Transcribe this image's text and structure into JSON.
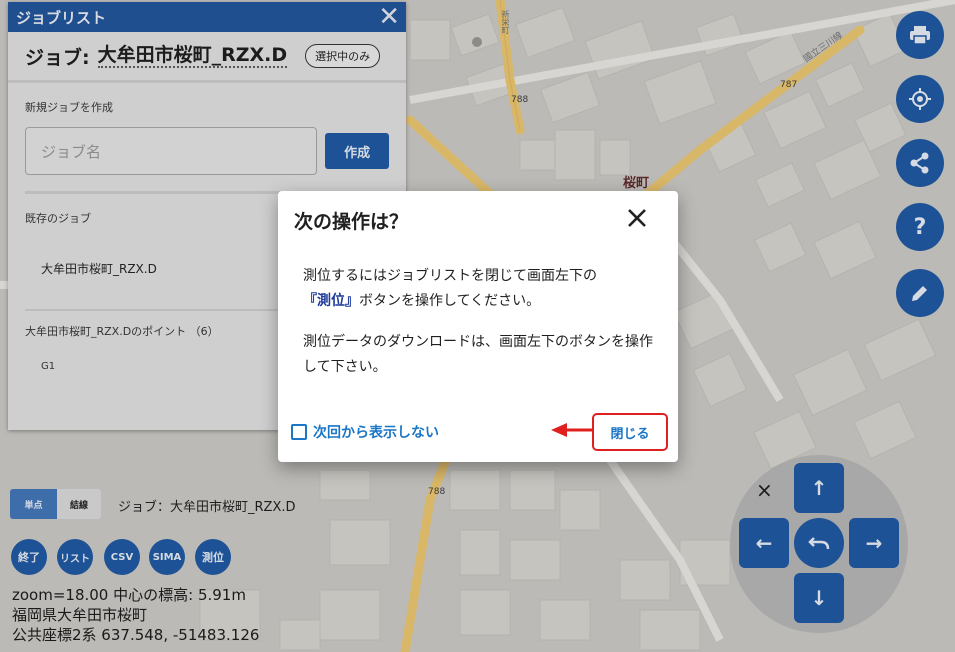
{
  "map": {
    "labels": {
      "road_788_a": "788",
      "road_787": "787",
      "road_788_b": "788",
      "district": "桜町",
      "road_sign_a": "新栄町",
      "road_sign_b": "國立三川線"
    },
    "colors": {
      "background": "#bcbab6",
      "road_major": "#d4b46a",
      "road_minor": "#cfcdc9",
      "building": "#c9c7c2"
    }
  },
  "joblist": {
    "title": "ジョブリスト",
    "job_label": "ジョブ:",
    "job_name": "大牟田市桜町_RZX.D",
    "select_only_label": "選択中のみ",
    "new_job_label": "新規ジョブを作成",
    "job_input_placeholder": "ジョブ名",
    "create_label": "作成",
    "existing_jobs_label": "既存のジョブ",
    "existing_jobs": [
      "大牟田市桜町_RZX.D"
    ],
    "points_label": "大牟田市桜町_RZX.Dのポイント （6）",
    "points": [
      "G1"
    ]
  },
  "right_buttons": {
    "print": "print-icon",
    "locate": "crosshair-icon",
    "share": "share-icon",
    "help": "?",
    "edit": "pencil-icon"
  },
  "bottom": {
    "mode_single": "単点",
    "mode_line": "結線",
    "job_status": "ジョブ：大牟田市桜町_RZX.D",
    "buttons": [
      "終了",
      "リスト",
      "CSV",
      "SIMA",
      "測位"
    ],
    "info_zoom": "zoom=18.00 中心の標高: 5.91m",
    "info_address": "福岡県大牟田市桜町",
    "info_coords": "公共座標2系 637.548, -51483.126"
  },
  "dpad": {
    "close": "×",
    "up": "↑",
    "down": "↓",
    "left": "←",
    "right": "→",
    "center": "undo-icon"
  },
  "modal": {
    "title": "次の操作は？",
    "p1_a": "測位するにはジョブリストを閉じて画面左下の",
    "p1_emph": "『測位』",
    "p1_b": "ボタンを操作してください。",
    "p2": "測位データのダウンロードは、画面左下のボタンを操作して下さい。",
    "dont_show": "次回から表示しない",
    "close": "閉じる",
    "accent": "#1b76c6",
    "highlight": "#e0201e"
  }
}
